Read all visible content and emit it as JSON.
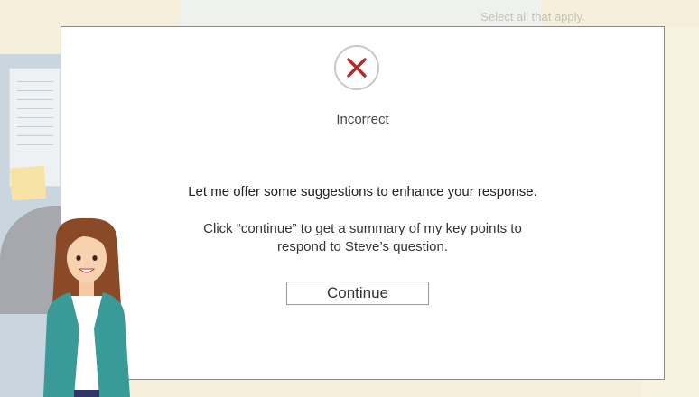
{
  "background": {
    "prompt_text": "Select all that apply."
  },
  "modal": {
    "status": "Incorrect",
    "status_icon": "x-circle-icon",
    "message": "Let me offer some suggestions to enhance your response.",
    "instruction_line1": "Click “continue” to get a summary of my key points to",
    "instruction_line2": "respond to Steve’s question.",
    "continue_label": "Continue"
  },
  "colors": {
    "incorrect_red": "#b42a2a",
    "modal_bg": "#ffffff",
    "character_jacket": "#3a9a98",
    "character_hair": "#8a4a28"
  }
}
